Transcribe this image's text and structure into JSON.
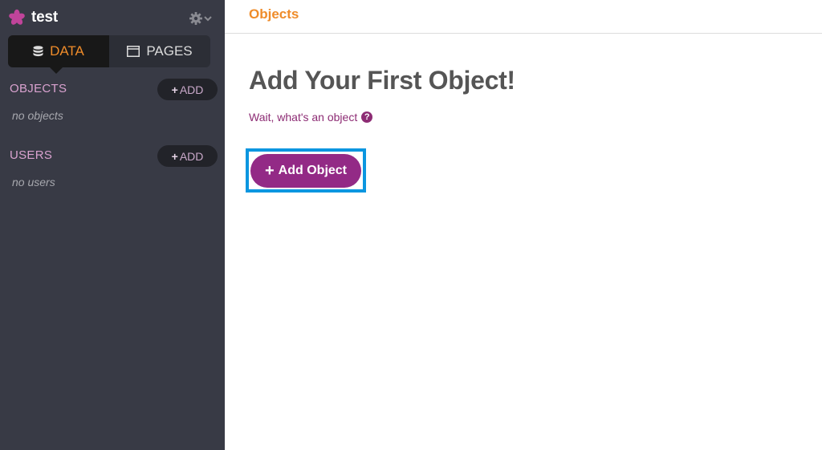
{
  "app": {
    "name": "test",
    "logo_icon": "asterisk-icon",
    "settings_icon": "gear-icon",
    "brand_color": "#932a86",
    "accent_color": "#ef8c2a"
  },
  "sidebar": {
    "tabs": [
      {
        "label": "DATA",
        "icon": "database-icon",
        "active": true
      },
      {
        "label": "PAGES",
        "icon": "window-icon",
        "active": false
      }
    ],
    "sections": [
      {
        "title": "OBJECTS",
        "add_label": "ADD",
        "empty_text": "no objects"
      },
      {
        "title": "USERS",
        "add_label": "ADD",
        "empty_text": "no users"
      }
    ]
  },
  "header": {
    "breadcrumb": "Objects"
  },
  "main": {
    "title": "Add Your First Object!",
    "help_text": "Wait, what's an object",
    "help_icon": "question-circle-icon",
    "add_button_label": "Add Object",
    "add_button_icon": "plus-icon",
    "highlight_color": "#0b96e0"
  }
}
